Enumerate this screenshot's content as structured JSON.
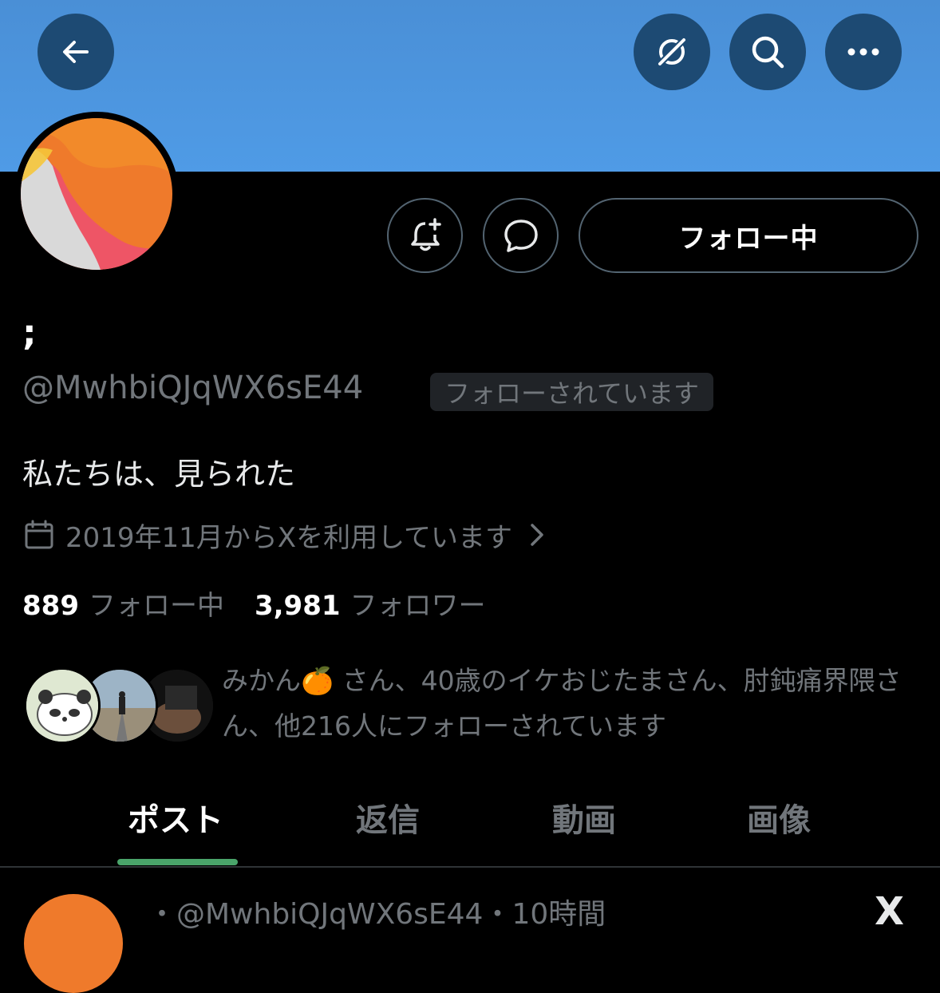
{
  "profile": {
    "name": ";",
    "handle": "@MwhbiQJqWX6sE44",
    "follows_you_badge": "フォローされています",
    "bio": "私たちは、見られた",
    "joined": "2019年11月からXを利用しています",
    "following_count": "889",
    "following_label": "フォロー中",
    "followers_count": "3,981",
    "followers_label": "フォロワー",
    "followed_by": "みかん🍊 さん、40歳のイケおじたまさん、肘鈍痛界隈さん、他216人にフォローされています"
  },
  "actions": {
    "follow_button": "フォロー中"
  },
  "tabs": [
    "ポスト",
    "返信",
    "動画",
    "画像"
  ],
  "post": {
    "meta": "・@MwhbiQJqWX6sE44・10時間",
    "logo": "X"
  },
  "colors": {
    "banner": "#4f9be6",
    "nav_button": "#1d4a73",
    "tab_underline": "#4aa46a"
  },
  "icons": {
    "back": "arrow-left-icon",
    "grok": "grok-icon",
    "search": "search-icon",
    "more": "more-icon",
    "notify": "bell-plus-icon",
    "message": "chat-bubble-icon",
    "calendar": "calendar-icon",
    "chevron": "chevron-right-icon"
  }
}
